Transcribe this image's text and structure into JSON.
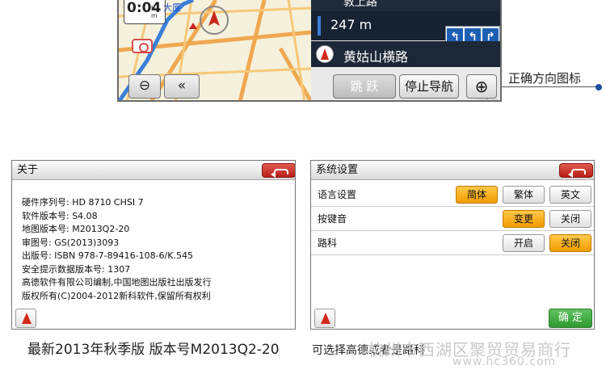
{
  "nav_screen": {
    "time": "0:04",
    "time_unit_h": "h",
    "time_unit_m": "m",
    "place_label": "大厦",
    "zoom_out_symbol": "⊖",
    "back_symbol": "«",
    "current_road_partial": "敦上路",
    "distance": "247 m",
    "lane_arrows": [
      "↰",
      "↰",
      "↱"
    ],
    "next_road": "黄姑山横路",
    "skip_label": "跳 跃",
    "stop_nav_label": "停止导航",
    "zoom_in_symbol": "⊕"
  },
  "callout": {
    "label": "正确方向图标"
  },
  "about_dialog": {
    "title": "关于",
    "lines": [
      "硬件序列号:  HD 8710 CHSI 7",
      "软件版本号:  S4.08",
      "地图版本号:  M2013Q2-20",
      "审图号:  GS(2013)3093",
      "出版号:  ISBN 978-7-89416-108-6/K.545",
      "安全提示数据版本号:  1307",
      "高德软件有限公司编制,中国地图出版社出版发行",
      "版权所有(C)2004-2012新科软件,保留所有权利"
    ]
  },
  "settings_dialog": {
    "title": "系统设置",
    "rows": [
      {
        "label": "语言设置",
        "options": [
          "简体",
          "繁体",
          "英文"
        ],
        "selected": 0
      },
      {
        "label": "按键音",
        "options": [
          "变更",
          "关闭"
        ],
        "selected": 0
      },
      {
        "label": "路科",
        "options": [
          "开启",
          "关闭"
        ],
        "selected": 1
      }
    ],
    "confirm_label": "确 定"
  },
  "captions": {
    "left": "最新2013年秋季版 版本号M2013Q2-20",
    "right": "可选择高德或者是路科"
  },
  "watermark": "杭州市西湖区聚贸贸易商行",
  "watermark_url": "www.hc360.com",
  "colors": {
    "accent_orange": "#f29a00",
    "confirm_green": "#2f9a2f",
    "back_red": "#c0261c",
    "callout_dot": "#1a4f9e"
  }
}
